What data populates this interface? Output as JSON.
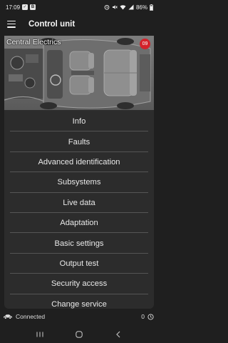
{
  "status_bar": {
    "time": "17:09",
    "battery": "86%",
    "notif_icons": [
      "check-box-icon",
      "b-app-icon"
    ],
    "sys_icons": [
      "alarm-icon",
      "mute-icon",
      "wifi-icon",
      "signal-icon",
      "battery-icon"
    ]
  },
  "app_bar": {
    "title": "Control unit"
  },
  "hero": {
    "label": "Central Electrics",
    "badge": "09"
  },
  "menu": {
    "items": [
      {
        "label": "Info"
      },
      {
        "label": "Faults"
      },
      {
        "label": "Advanced identification"
      },
      {
        "label": "Subsystems"
      },
      {
        "label": "Live data"
      },
      {
        "label": "Adaptation"
      },
      {
        "label": "Basic settings"
      },
      {
        "label": "Output test"
      },
      {
        "label": "Security access"
      },
      {
        "label": "Change service"
      }
    ]
  },
  "connection": {
    "status": "Connected",
    "count": "0"
  },
  "colors": {
    "background": "#1f1f1f",
    "panel": "#2c2c2c",
    "badge": "#d3232b",
    "divider": "#555555"
  }
}
